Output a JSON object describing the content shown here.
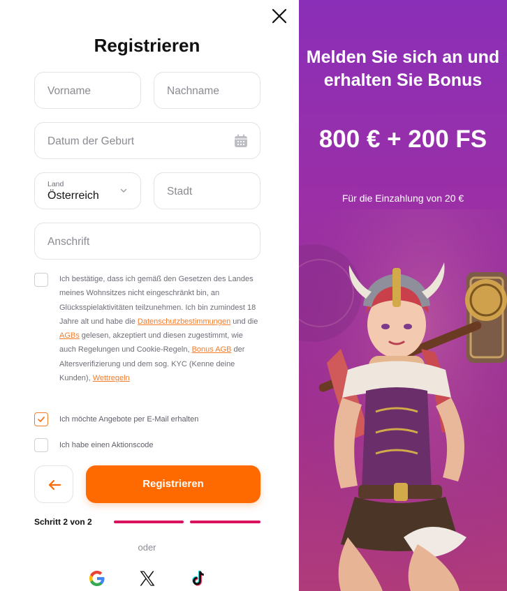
{
  "form": {
    "title": "Registrieren",
    "first_name_placeholder": "Vorname",
    "last_name_placeholder": "Nachname",
    "birthdate_placeholder": "Datum der Geburt",
    "country_label": "Land",
    "country_value": "Österreich",
    "city_placeholder": "Stadt",
    "address_placeholder": "Anschrift"
  },
  "consent": {
    "text_1": "Ich bestätige, dass ich gemäß den Gesetzen des Landes meines Wohnsitzes nicht eingeschränkt bin, an Glücksspielaktivitäten teilzunehmen. Ich bin zumindest 18 Jahre alt und habe die ",
    "link_privacy": "Datenschutzbestimmungen",
    "text_2": " und die ",
    "link_terms": "AGBs",
    "text_3": " gelesen, akzeptiert und diesen zugestimmt, wie auch Regelungen und Cookie-Regeln, ",
    "link_bonus": "Bonus AGB",
    "text_4": " der Altersverifizierung und dem sog. KYC (Kenne deine Kunden), ",
    "link_betting": "Wettregeln",
    "consent_checked": false,
    "offers_label": "Ich möchte Angebote per E-Mail erhalten",
    "offers_checked": true,
    "promo_label": "Ich habe einen Aktionscode",
    "promo_checked": false
  },
  "actions": {
    "register_label": "Registrieren",
    "step_label": "Schritt 2 von 2",
    "step_current": 2,
    "step_total": 2,
    "or_label": "oder"
  },
  "social": [
    "google-icon",
    "x-icon",
    "tiktok-icon"
  ],
  "promo": {
    "headline": "Melden Sie sich an und erhalten Sie Bonus",
    "amount": "800 € + 200 FS",
    "subline": "Für die Einzahlung von 20 €"
  },
  "colors": {
    "accent": "#ff6a00",
    "link": "#f27c2a",
    "progress": "#d9135e",
    "promo_bg": "#9b2fa6"
  }
}
